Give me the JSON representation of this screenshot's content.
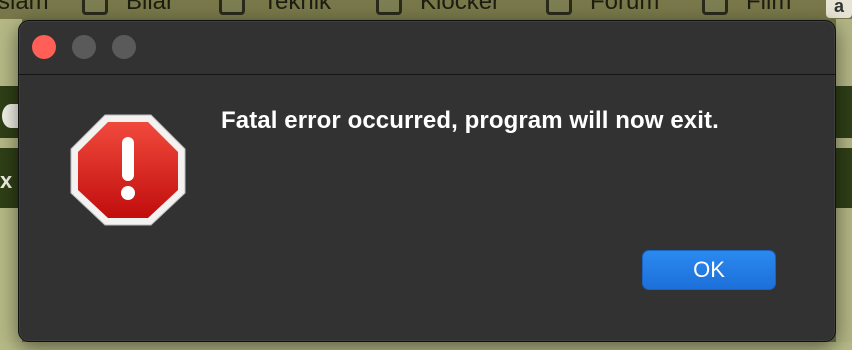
{
  "background_page": {
    "nav_items": [
      {
        "label": "slam"
      },
      {
        "label": "Bilar"
      },
      {
        "label": "Teknik"
      },
      {
        "label": "Klocker"
      },
      {
        "label": "Forum"
      },
      {
        "label": "Film"
      }
    ],
    "corner_logo_glyph": "a",
    "side_close_glyph": "x"
  },
  "dialog": {
    "traffic_lights": {
      "close_color": "#ff5f57",
      "minimize_color": "#5a5a5a",
      "maximize_color": "#5a5a5a"
    },
    "icon": {
      "name": "stop-alert-icon",
      "color": "#d81e1e",
      "glyph": "!"
    },
    "message": "Fatal error occurred, program will now exit.",
    "ok_button": {
      "label": "OK",
      "color": "#1d6fd9"
    }
  }
}
